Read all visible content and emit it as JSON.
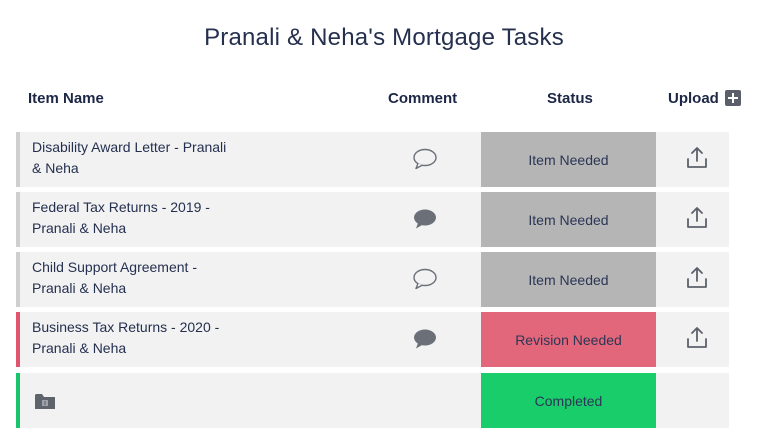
{
  "page": {
    "title": "Pranali & Neha's Mortgage Tasks"
  },
  "headers": {
    "item_name": "Item Name",
    "comment": "Comment",
    "status": "Status",
    "upload": "Upload",
    "upload_add_icon": "plus-square-icon"
  },
  "rows": [
    {
      "name_line1": "Disability Award Letter - Pranali",
      "name_line2": "& Neha",
      "comment_icon": "speech-bubble-outline-icon",
      "status": "Item Needed",
      "upload_icon": "upload-icon"
    },
    {
      "name_line1": "Federal Tax Returns - 2019 -",
      "name_line2": "Pranali & Neha",
      "comment_icon": "speech-bubble-filled-icon",
      "status": "Item Needed",
      "upload_icon": "upload-icon"
    },
    {
      "name_line1": "Child Support Agreement -",
      "name_line2": "Pranali & Neha",
      "comment_icon": "speech-bubble-outline-icon",
      "status": "Item Needed",
      "upload_icon": "upload-icon"
    },
    {
      "name_line1": "Business Tax Returns - 2020 -",
      "name_line2": "Pranali & Neha",
      "comment_icon": "speech-bubble-filled-icon",
      "status": "Revision Needed",
      "upload_icon": "upload-icon"
    },
    {
      "row_icon": "folder-icon",
      "status": "Completed"
    }
  ],
  "colors": {
    "status_item_needed": "#b5b5b5",
    "status_revision_needed": "#e3677a",
    "status_completed": "#18cd6a",
    "accent_revision": "#e0556e",
    "accent_completed": "#19c46a"
  }
}
